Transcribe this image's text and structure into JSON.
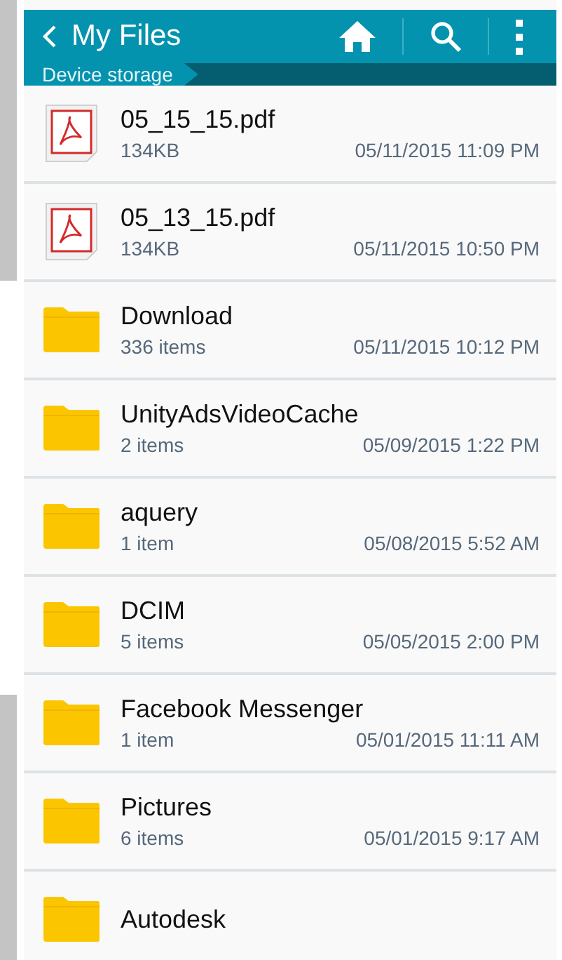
{
  "app_bar": {
    "title": "My Files"
  },
  "breadcrumb": [
    {
      "label": "Device storage",
      "selected": true
    }
  ],
  "files": [
    {
      "kind": "pdf",
      "name": "05_15_15.pdf",
      "detail": "134KB",
      "modified": "05/11/2015 11:09 PM"
    },
    {
      "kind": "pdf",
      "name": "05_13_15.pdf",
      "detail": "134KB",
      "modified": "05/11/2015 10:50 PM"
    },
    {
      "kind": "folder",
      "name": "Download",
      "detail": "336 items",
      "modified": "05/11/2015 10:12 PM"
    },
    {
      "kind": "folder",
      "name": "UnityAdsVideoCache",
      "detail": "2 items",
      "modified": "05/09/2015 1:22 PM"
    },
    {
      "kind": "folder",
      "name": "aquery",
      "detail": "1 item",
      "modified": "05/08/2015 5:52 AM"
    },
    {
      "kind": "folder",
      "name": "DCIM",
      "detail": "5 items",
      "modified": "05/05/2015 2:00 PM"
    },
    {
      "kind": "folder",
      "name": "Facebook Messenger",
      "detail": "1 item",
      "modified": "05/01/2015 11:11 AM"
    },
    {
      "kind": "folder",
      "name": "Pictures",
      "detail": "6 items",
      "modified": "05/01/2015 9:17 AM"
    },
    {
      "kind": "folder",
      "name": "Autodesk"
    }
  ]
}
